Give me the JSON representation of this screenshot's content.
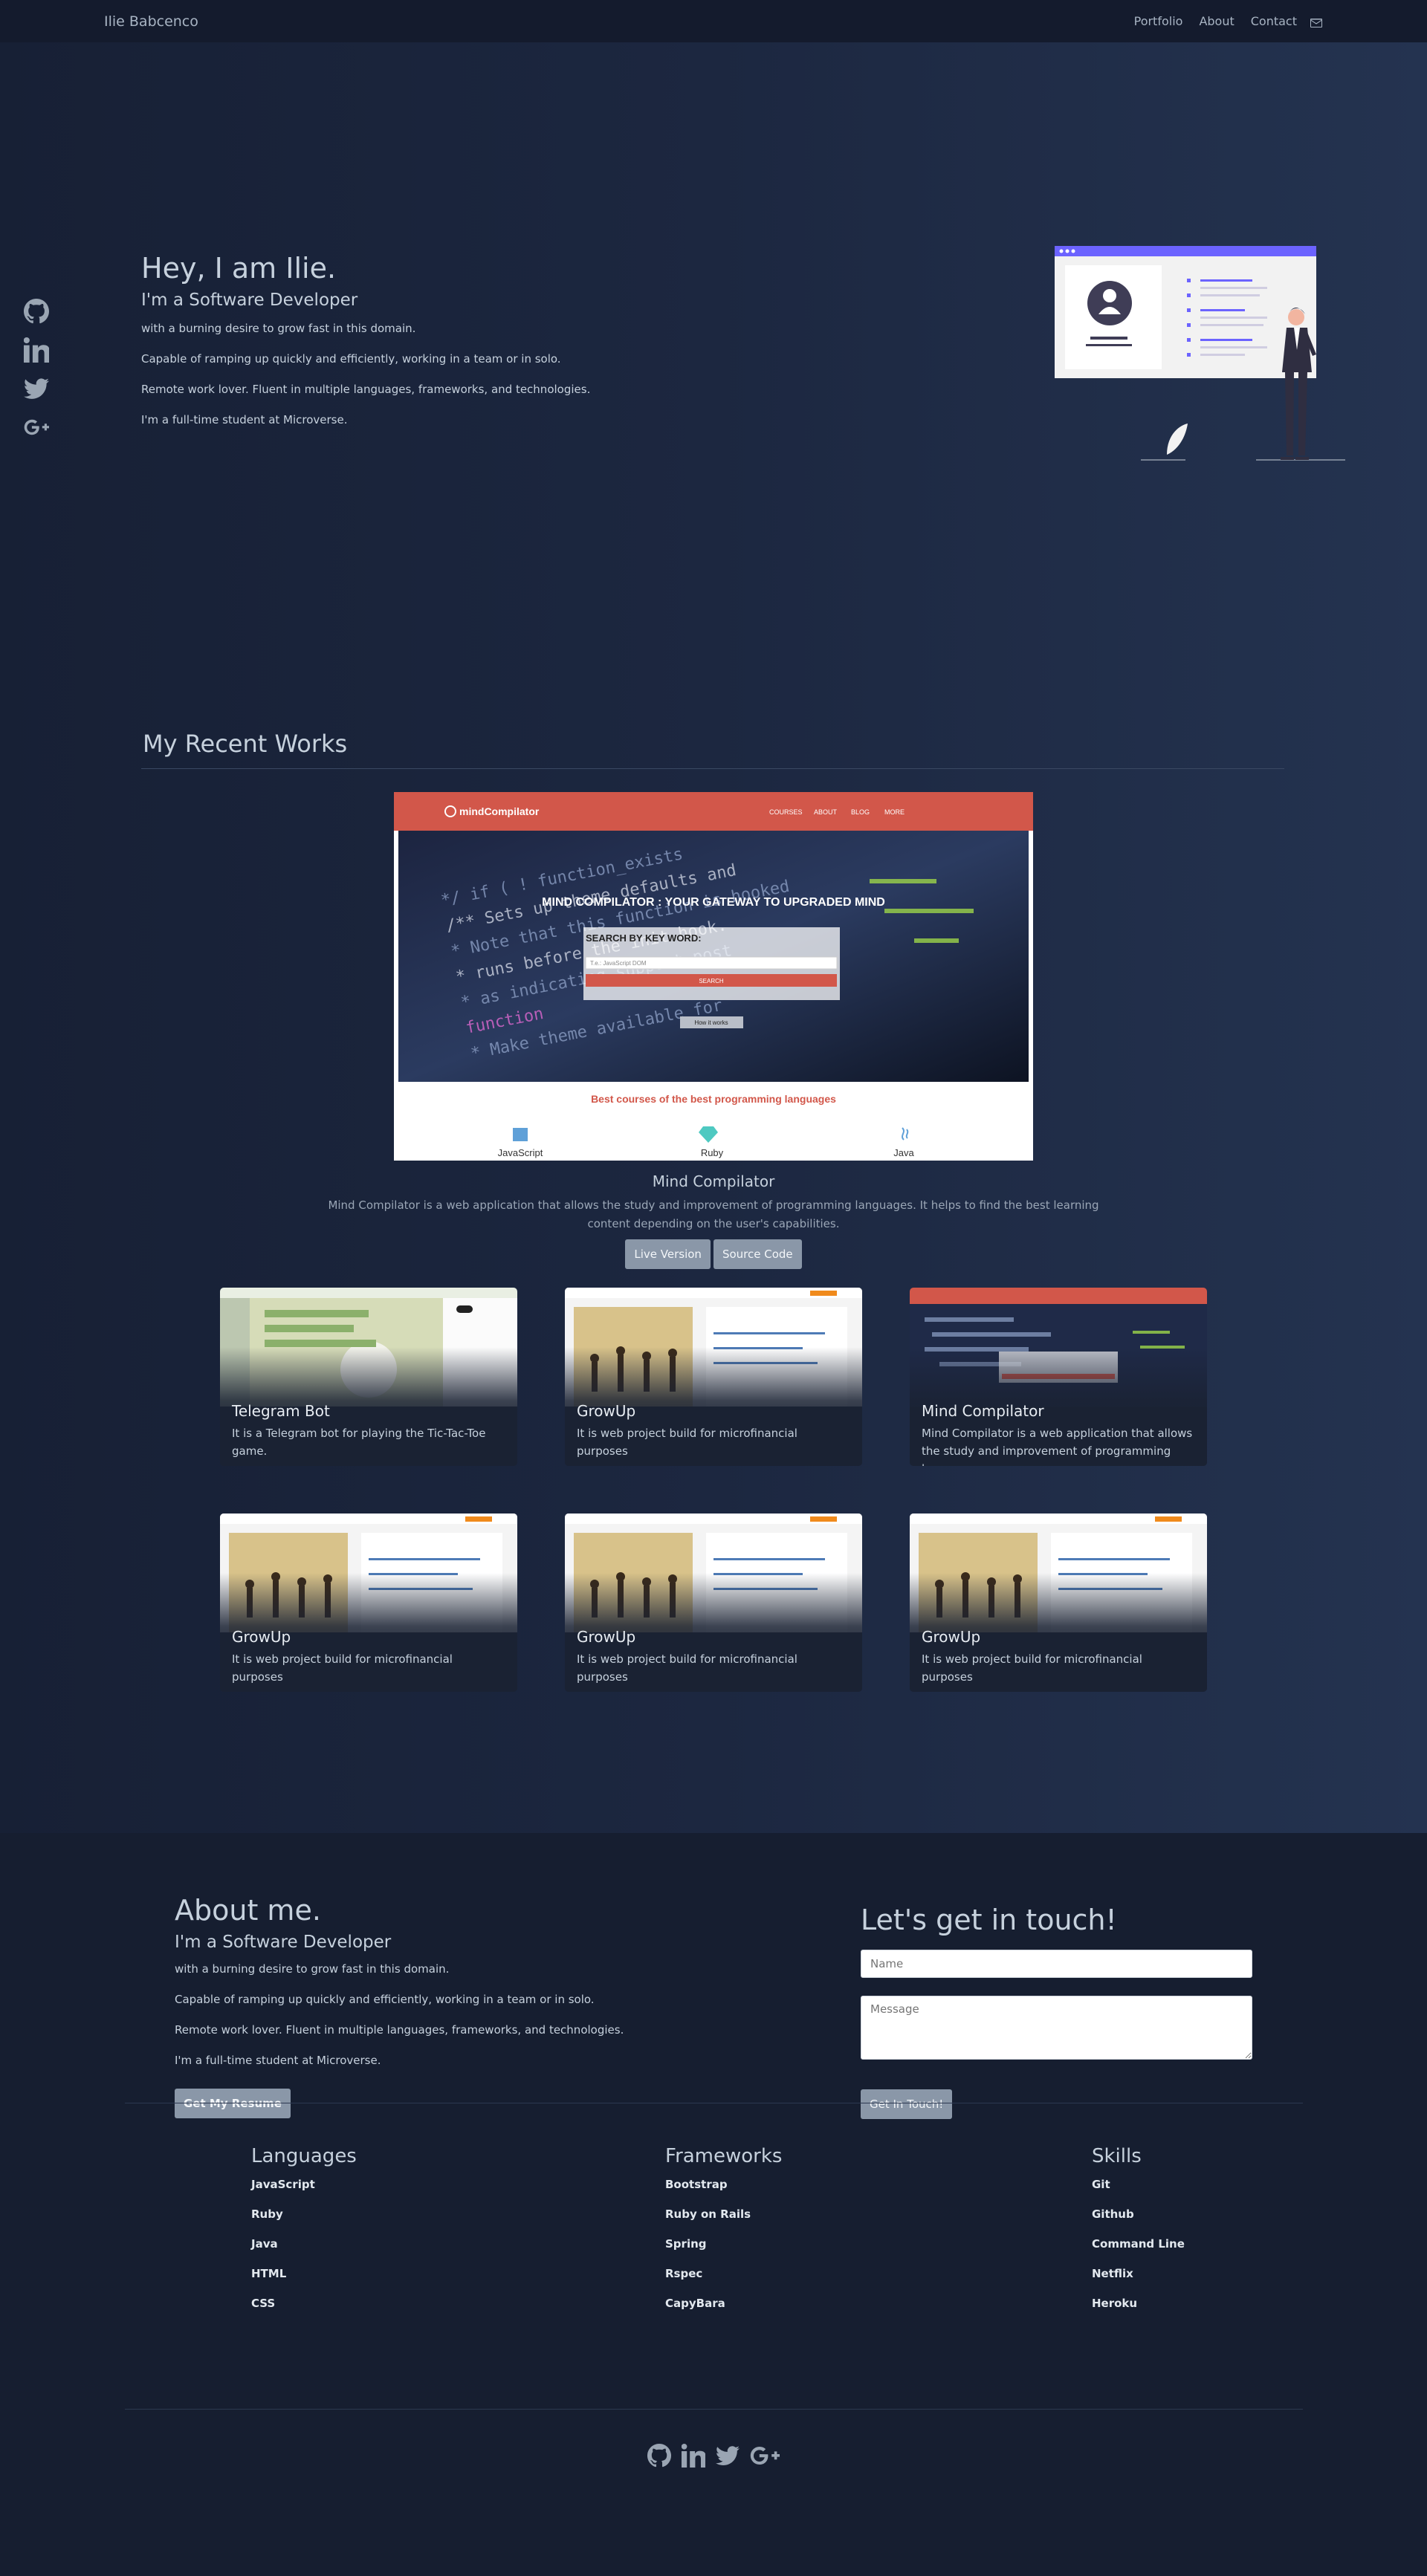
{
  "navbar": {
    "brand": "Ilie Babcenco",
    "links": [
      "Portfolio",
      "About",
      "Contact"
    ]
  },
  "hero": {
    "title": "Hey, I am Ilie.",
    "subtitle": "I'm a Software Developer",
    "lines": [
      "with a burning desire to grow fast in this domain.",
      "Capable of ramping up quickly and efficiently, working in a team or in solo.",
      "Remote work lover. Fluent in multiple languages, frameworks, and technologies.",
      "I'm a full-time student at Microverse."
    ]
  },
  "social_icons": [
    "github-icon",
    "linkedin-icon",
    "twitter-icon",
    "google-plus-icon"
  ],
  "works": {
    "title": "My Recent Works",
    "featured": {
      "screenshot": {
        "logo": "mindCompilator",
        "nav": [
          "COURSES",
          "ABOUT",
          "BLOG",
          "MORE"
        ],
        "headline": "MIND COMPILATOR : YOUR GATEWAY TO UPGRADED MIND",
        "search_label": "SEARCH BY KEY WORD:",
        "search_placeholder": "T.e.: JavaScript DOM",
        "search_button": "SEARCH",
        "how_button": "How it works",
        "section_title": "Best courses of the best programming languages",
        "languages": [
          "JavaScript",
          "Ruby",
          "Java"
        ]
      },
      "title": "Mind Compilator",
      "description": "Mind Compilator is a web application that allows the study and improvement of programming languages. It helps to find the best learning content depending on the user's capabilities.",
      "live_label": "Live Version",
      "source_label": "Source Code"
    },
    "cards": [
      {
        "title": "Telegram Bot",
        "description": "It is a Telegram bot for playing the Tic-Tac-Toe game.",
        "shot": "telegram"
      },
      {
        "title": "GrowUp",
        "description": "It is web project build for microfinancial purposes",
        "shot": "growup"
      },
      {
        "title": "Mind Compilator",
        "description": "Mind Compilator is a web application that allows the study and improvement of programming languages.",
        "shot": "mind"
      },
      {
        "title": "GrowUp",
        "description": "It is web project build for microfinancial purposes",
        "shot": "growup"
      },
      {
        "title": "GrowUp",
        "description": "It is web project build for microfinancial purposes",
        "shot": "growup"
      },
      {
        "title": "GrowUp",
        "description": "It is web project build for microfinancial purposes",
        "shot": "growup"
      }
    ]
  },
  "about": {
    "title": "About me.",
    "subtitle": "I'm a Software Developer",
    "lines": [
      "with a burning desire to grow fast in this domain.",
      "Capable of ramping up quickly and efficiently, working in a team or in solo.",
      "Remote work lover. Fluent in multiple languages, frameworks, and technologies.",
      "I'm a full-time student at Microverse."
    ],
    "resume_button": "Get My Resume"
  },
  "contact": {
    "title": "Let's get in touch!",
    "name_placeholder": "Name",
    "message_placeholder": "Message",
    "submit_label": "Get In Touch!"
  },
  "lists": [
    {
      "title": "Languages",
      "items": [
        "JavaScript",
        "Ruby",
        "Java",
        "HTML",
        "CSS"
      ]
    },
    {
      "title": "Frameworks",
      "items": [
        "Bootstrap",
        "Ruby on Rails",
        "Spring",
        "Rspec",
        "CapyBara"
      ]
    },
    {
      "title": "Skills",
      "items": [
        "Git",
        "Github",
        "Command Line",
        "Netflix",
        "Heroku"
      ]
    }
  ],
  "colors": {
    "accent_red": "#d2574a",
    "illustration_purple": "#6c63ff",
    "orange_badge": "#f08a1c"
  }
}
